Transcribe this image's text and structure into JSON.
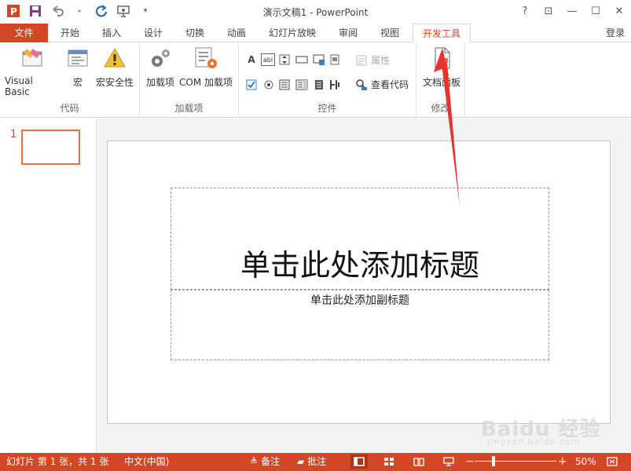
{
  "window": {
    "title": "演示文稿1 - PowerPoint",
    "help": "?",
    "ribbon_display": "⊡",
    "minimize": "—",
    "maximize": "☐",
    "close": "✕"
  },
  "qat": {
    "app_logo": "P",
    "save": "save-icon",
    "undo": "undo-icon",
    "redo": "redo-icon",
    "present": "present-icon",
    "customize": "▾"
  },
  "tabs": {
    "file": "文件",
    "items": [
      "开始",
      "插入",
      "设计",
      "切换",
      "动画",
      "幻灯片放映",
      "审阅",
      "视图",
      "开发工具"
    ],
    "active": "开发工具",
    "login": "登录"
  },
  "ribbon": {
    "code": {
      "label": "代码",
      "visual_basic": "Visual Basic",
      "macro": "宏",
      "macro_security": "宏安全性"
    },
    "addins": {
      "label": "加载项",
      "addins": "加载项",
      "com_addins": "COM 加载项"
    },
    "controls": {
      "label": "控件",
      "properties": "属性",
      "view_code": "查看代码",
      "label_glyph": "A",
      "textbox_glyph": "abl"
    },
    "modify": {
      "label": "修改",
      "doc_panel": "文档面板"
    }
  },
  "thumbnails": {
    "slide_number": "1"
  },
  "slide": {
    "title_placeholder": "单击此处添加标题",
    "subtitle_placeholder": "单击此处添加副标题"
  },
  "statusbar": {
    "slide_info": "幻灯片 第 1 张，共 1 张",
    "language": "中文(中国)",
    "notes": "备注",
    "comments": "批注",
    "zoom_out": "−",
    "zoom_in": "+",
    "zoom": "50%"
  },
  "watermark": {
    "brand": "Baidu 经验",
    "url": "jingyan.baidu.com"
  },
  "colors": {
    "accent": "#d24726",
    "arrow": "#e8322e"
  }
}
